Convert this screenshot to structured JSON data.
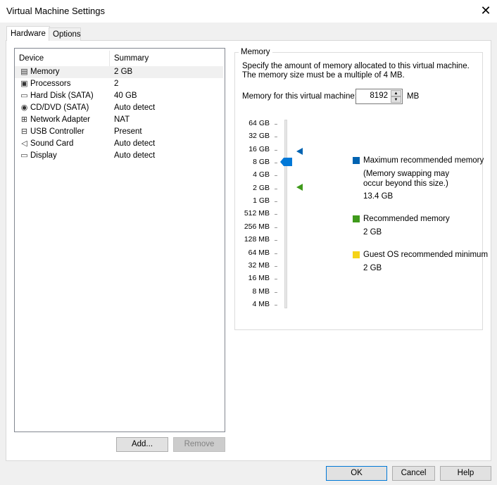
{
  "window": {
    "title": "Virtual Machine Settings"
  },
  "tabs": [
    {
      "label": "Hardware",
      "active": true
    },
    {
      "label": "Options",
      "active": false
    }
  ],
  "device_list": {
    "headers": [
      "Device",
      "Summary"
    ],
    "rows": [
      {
        "device": "Memory",
        "summary": "2 GB",
        "icon": "memory-icon",
        "selected": true
      },
      {
        "device": "Processors",
        "summary": "2",
        "icon": "processor-icon"
      },
      {
        "device": "Hard Disk (SATA)",
        "summary": "40 GB",
        "icon": "hard-disk-icon"
      },
      {
        "device": "CD/DVD (SATA)",
        "summary": "Auto detect",
        "icon": "cd-dvd-icon"
      },
      {
        "device": "Network Adapter",
        "summary": "NAT",
        "icon": "network-icon"
      },
      {
        "device": "USB Controller",
        "summary": "Present",
        "icon": "usb-icon"
      },
      {
        "device": "Sound Card",
        "summary": "Auto detect",
        "icon": "speaker-icon"
      },
      {
        "device": "Display",
        "summary": "Auto detect",
        "icon": "monitor-icon"
      }
    ],
    "add_label": "Add...",
    "remove_label": "Remove"
  },
  "memory": {
    "group_label": "Memory",
    "description": "Specify the amount of memory allocated to this virtual machine. The memory size must be a multiple of 4 MB.",
    "field_label": "Memory for this virtual machine:",
    "value": "8192",
    "unit": "MB",
    "scale": [
      "64 GB",
      "32 GB",
      "16 GB",
      "8 GB",
      "4 GB",
      "2 GB",
      "1 GB",
      "512 MB",
      "256 MB",
      "128 MB",
      "64 MB",
      "32 MB",
      "16 MB",
      "8 MB",
      "4 MB"
    ],
    "slider_value": "8 GB",
    "legend": {
      "max_label": "Maximum recommended memory",
      "max_note": "(Memory swapping may occur beyond this size.)",
      "max_value": "13.4 GB",
      "max_color": "#0063b1",
      "rec_label": "Recommended memory",
      "rec_value": "2 GB",
      "rec_color": "#3f9a1b",
      "min_label": "Guest OS recommended minimum",
      "min_value": "2 GB",
      "min_color": "#f5d318"
    }
  },
  "footer": {
    "ok": "OK",
    "cancel": "Cancel",
    "help": "Help"
  }
}
